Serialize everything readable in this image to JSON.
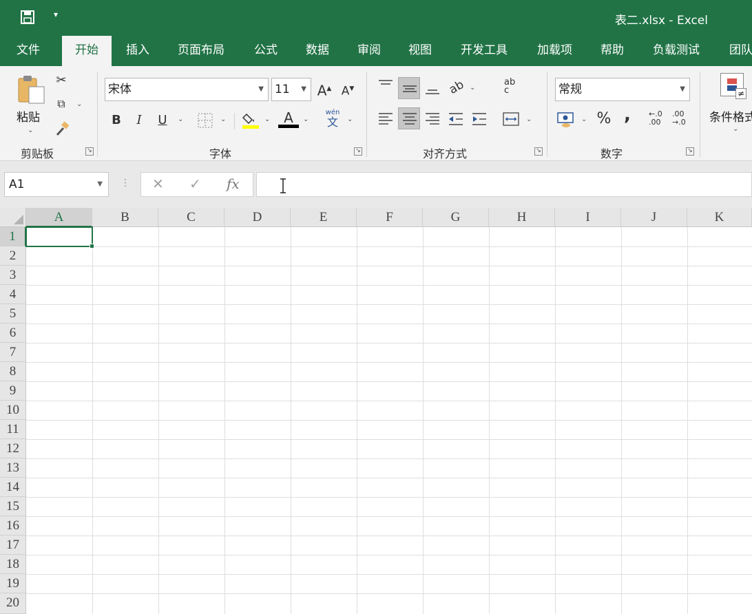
{
  "titlebar": {
    "title": "表二.xlsx  -  Excel",
    "save_icon": "save-icon",
    "customize_icon": "chevron-down-icon"
  },
  "tabs": [
    "文件",
    "开始",
    "插入",
    "页面布局",
    "公式",
    "数据",
    "审阅",
    "视图",
    "开发工具",
    "加载项",
    "帮助",
    "负载测试",
    "团队"
  ],
  "active_tab": "开始",
  "ribbon": {
    "clipboard": {
      "label": "剪贴板",
      "paste": "粘贴"
    },
    "font": {
      "label": "字体",
      "font_name": "宋体",
      "font_size": "11",
      "grow": "A",
      "shrink": "A",
      "bold": "B",
      "italic": "I",
      "underline": "U",
      "font_color_letter": "A",
      "phonetic_top": "wén",
      "phonetic_bottom": "文"
    },
    "alignment": {
      "label": "对齐方式",
      "wrap_top": "ab",
      "wrap_bottom": "c"
    },
    "number": {
      "label": "数字",
      "format": "常规",
      "percent": "%",
      "comma": ",",
      "inc_decimal_top": "←.0",
      "inc_decimal_bottom": ".00",
      "dec_decimal_top": ".00",
      "dec_decimal_bottom": "→.0"
    },
    "styles": {
      "conditional": "条件格式",
      "cond_symbol": "≠"
    }
  },
  "formula_bar": {
    "name_box": "A1",
    "cancel": "✕",
    "enter": "✓",
    "function": "fx",
    "value": ""
  },
  "sheet": {
    "columns": [
      "A",
      "B",
      "C",
      "D",
      "E",
      "F",
      "G",
      "H",
      "I",
      "J",
      "K"
    ],
    "rows": [
      "1",
      "2",
      "3",
      "4",
      "5",
      "6",
      "7",
      "8",
      "9",
      "10",
      "11",
      "12",
      "13",
      "14",
      "15",
      "16",
      "17",
      "18",
      "19",
      "20"
    ],
    "active_cell": "A1"
  },
  "colors": {
    "accent": "#217346",
    "ribbon_bg": "#f3f3f3",
    "highlight": "#ffff00",
    "font_color": "#000000"
  }
}
